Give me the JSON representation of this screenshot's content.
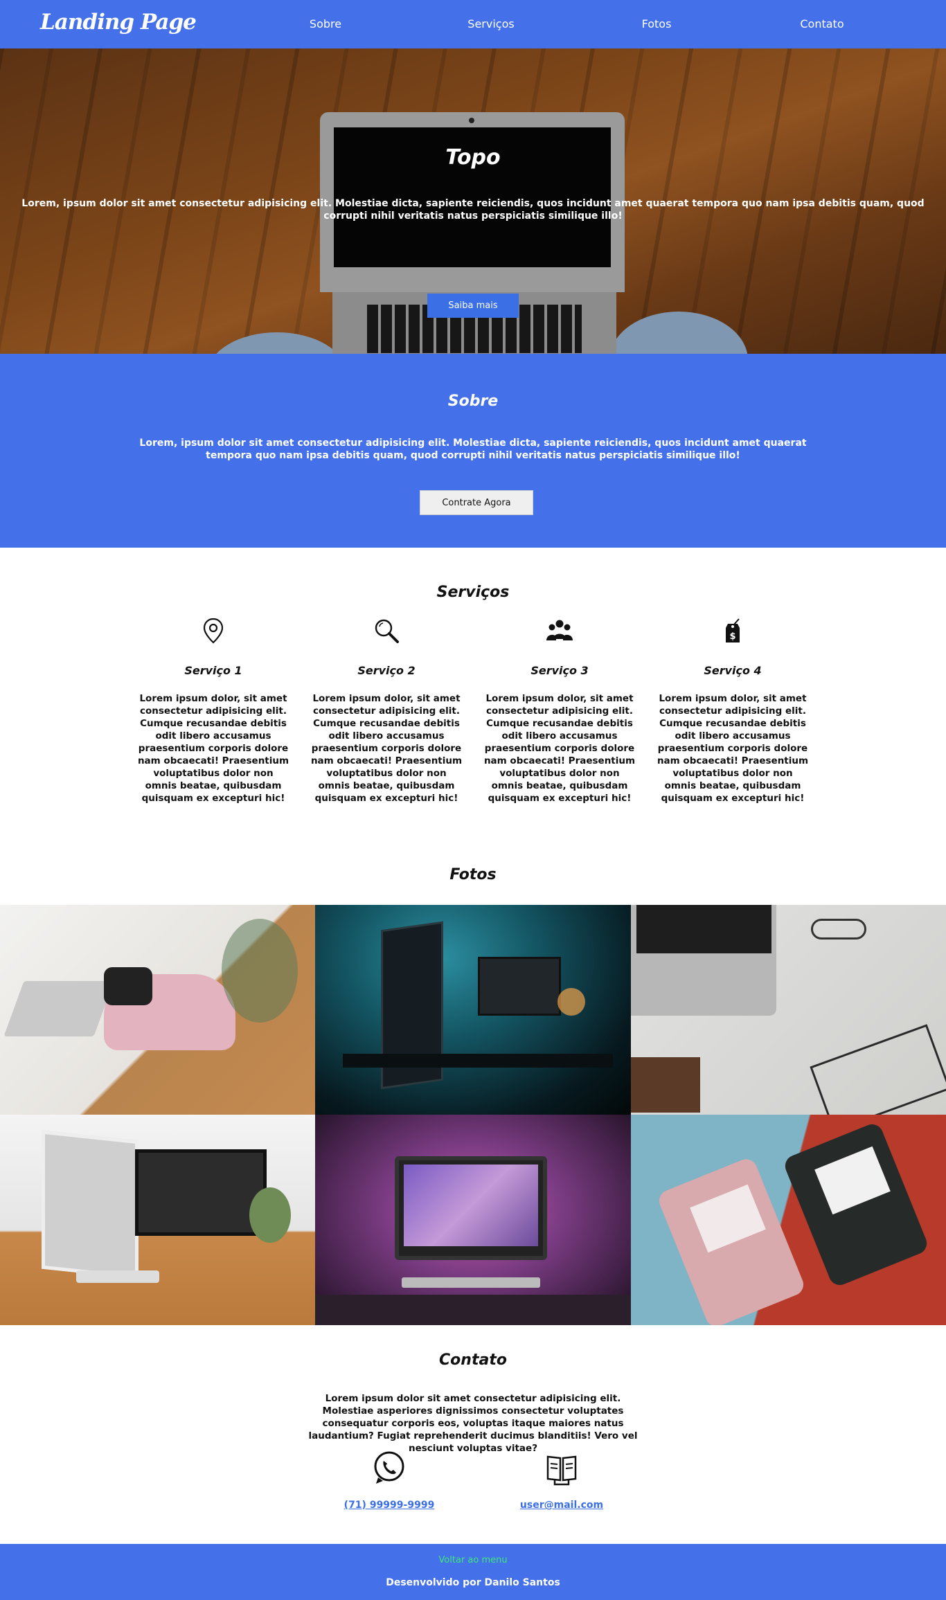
{
  "header": {
    "logo": "Landing Page",
    "nav": [
      "Sobre",
      "Serviços",
      "Fotos",
      "Contato"
    ]
  },
  "hero": {
    "title": "Topo",
    "text": "Lorem, ipsum dolor sit amet consectetur adipisicing elit. Molestiae dicta, sapiente reiciendis, quos incidunt amet quaerat tempora quo nam ipsa debitis quam, quod corrupti nihil veritatis natus perspiciatis similique illo!",
    "button": "Saiba mais"
  },
  "sobre": {
    "title": "Sobre",
    "text": "Lorem, ipsum dolor sit amet consectetur adipisicing elit. Molestiae dicta, sapiente reiciendis, quos incidunt amet quaerat tempora quo nam ipsa debitis quam, quod corrupti nihil veritatis natus perspiciatis similique illo!",
    "button": "Contrate Agora"
  },
  "servicos": {
    "title": "Serviços",
    "items": [
      {
        "icon": "map-pin-icon",
        "title": "Serviço 1",
        "text": "Lorem ipsum dolor, sit amet consectetur adipisicing elit. Cumque recusandae debitis odit libero accusamus praesentium corporis dolore nam obcaecati! Praesentium voluptatibus dolor non omnis beatae, quibusdam quisquam ex excepturi hic!"
      },
      {
        "icon": "magnifier-icon",
        "title": "Serviço 2",
        "text": "Lorem ipsum dolor, sit amet consectetur adipisicing elit. Cumque recusandae debitis odit libero accusamus praesentium corporis dolore nam obcaecati! Praesentium voluptatibus dolor non omnis beatae, quibusdam quisquam ex excepturi hic!"
      },
      {
        "icon": "users-group-icon",
        "title": "Serviço 3",
        "text": "Lorem ipsum dolor, sit amet consectetur adipisicing elit. Cumque recusandae debitis odit libero accusamus praesentium corporis dolore nam obcaecati! Praesentium voluptatibus dolor non omnis beatae, quibusdam quisquam ex excepturi hic!"
      },
      {
        "icon": "price-tag-icon",
        "title": "Serviço 4",
        "text": "Lorem ipsum dolor, sit amet consectetur adipisicing elit. Cumque recusandae debitis odit libero accusamus praesentium corporis dolore nam obcaecati! Praesentium voluptatibus dolor non omnis beatae, quibusdam quisquam ex excepturi hic!"
      }
    ]
  },
  "fotos": {
    "title": "Fotos"
  },
  "contato": {
    "title": "Contato",
    "text": "Lorem ipsum dolor sit amet consectetur adipisicing elit. Molestiae asperiores dignissimos consectetur voluptates consequatur corporis eos, voluptas itaque maiores natus laudantium? Fugiat reprehenderit ducimus blanditiis! Vero vel nesciunt voluptas vitae?",
    "phone": "(71) 99999-9999",
    "email": "user@mail.com"
  },
  "footer": {
    "back": "Voltar ao menu",
    "credit": "Desenvolvido por Danilo Santos"
  },
  "colors": {
    "primary": "#4471ea",
    "button": "#3b6fe6",
    "back_link": "#3ee87a"
  }
}
